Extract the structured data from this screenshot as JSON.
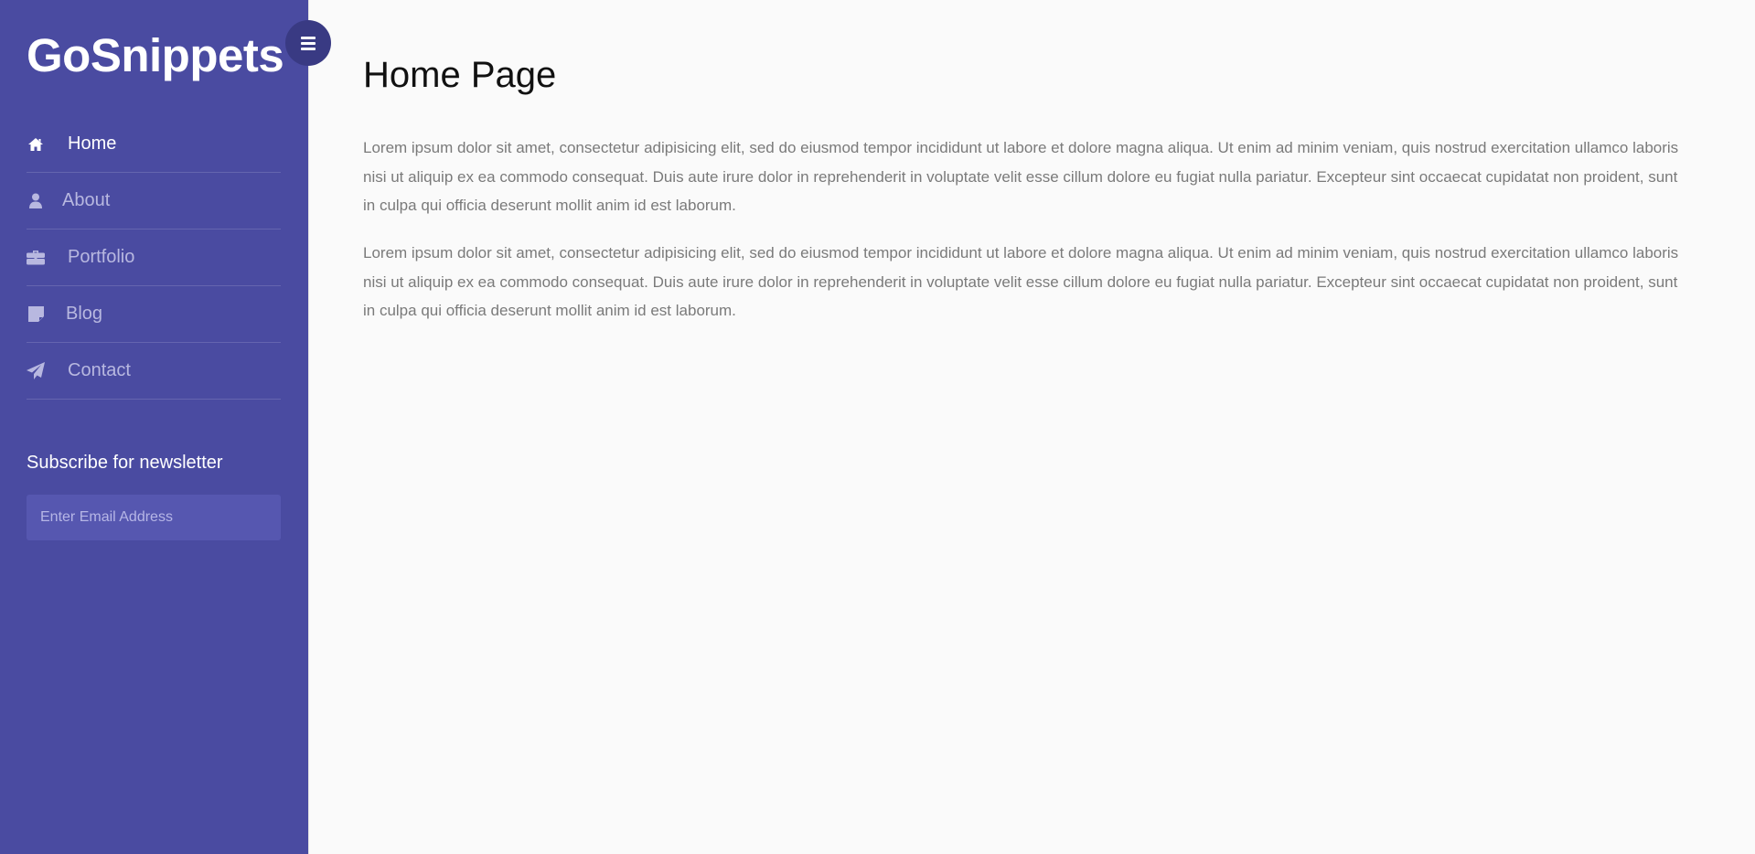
{
  "brand": "GoSnippets",
  "toggle_icon": "menu-icon",
  "nav": {
    "items": [
      {
        "label": "Home",
        "icon": "home-icon",
        "active": true
      },
      {
        "label": "About",
        "icon": "user-icon",
        "active": false
      },
      {
        "label": "Portfolio",
        "icon": "briefcase-icon",
        "active": false
      },
      {
        "label": "Blog",
        "icon": "sticky-note-icon",
        "active": false
      },
      {
        "label": "Contact",
        "icon": "paper-plane-icon",
        "active": false
      }
    ]
  },
  "newsletter": {
    "title": "Subscribe for newsletter",
    "placeholder": "Enter Email Address",
    "value": ""
  },
  "main": {
    "title": "Home Page",
    "paragraphs": [
      "Lorem ipsum dolor sit amet, consectetur adipisicing elit, sed do eiusmod tempor incididunt ut labore et dolore magna aliqua. Ut enim ad minim veniam, quis nostrud exercitation ullamco laboris nisi ut aliquip ex ea commodo consequat. Duis aute irure dolor in reprehenderit in voluptate velit esse cillum dolore eu fugiat nulla pariatur. Excepteur sint occaecat cupidatat non proident, sunt in culpa qui officia deserunt mollit anim id est laborum.",
      "Lorem ipsum dolor sit amet, consectetur adipisicing elit, sed do eiusmod tempor incididunt ut labore et dolore magna aliqua. Ut enim ad minim veniam, quis nostrud exercitation ullamco laboris nisi ut aliquip ex ea commodo consequat. Duis aute irure dolor in reprehenderit in voluptate velit esse cillum dolore eu fugiat nulla pariatur. Excepteur sint occaecat cupidatat non proident, sunt in culpa qui officia deserunt mollit anim id est laborum."
    ]
  },
  "colors": {
    "sidebar_bg": "#4a4ba1",
    "toggle_bg": "#393a83",
    "input_bg": "#5657b0",
    "main_bg": "#fafafa",
    "body_text": "#7a7a7a"
  }
}
